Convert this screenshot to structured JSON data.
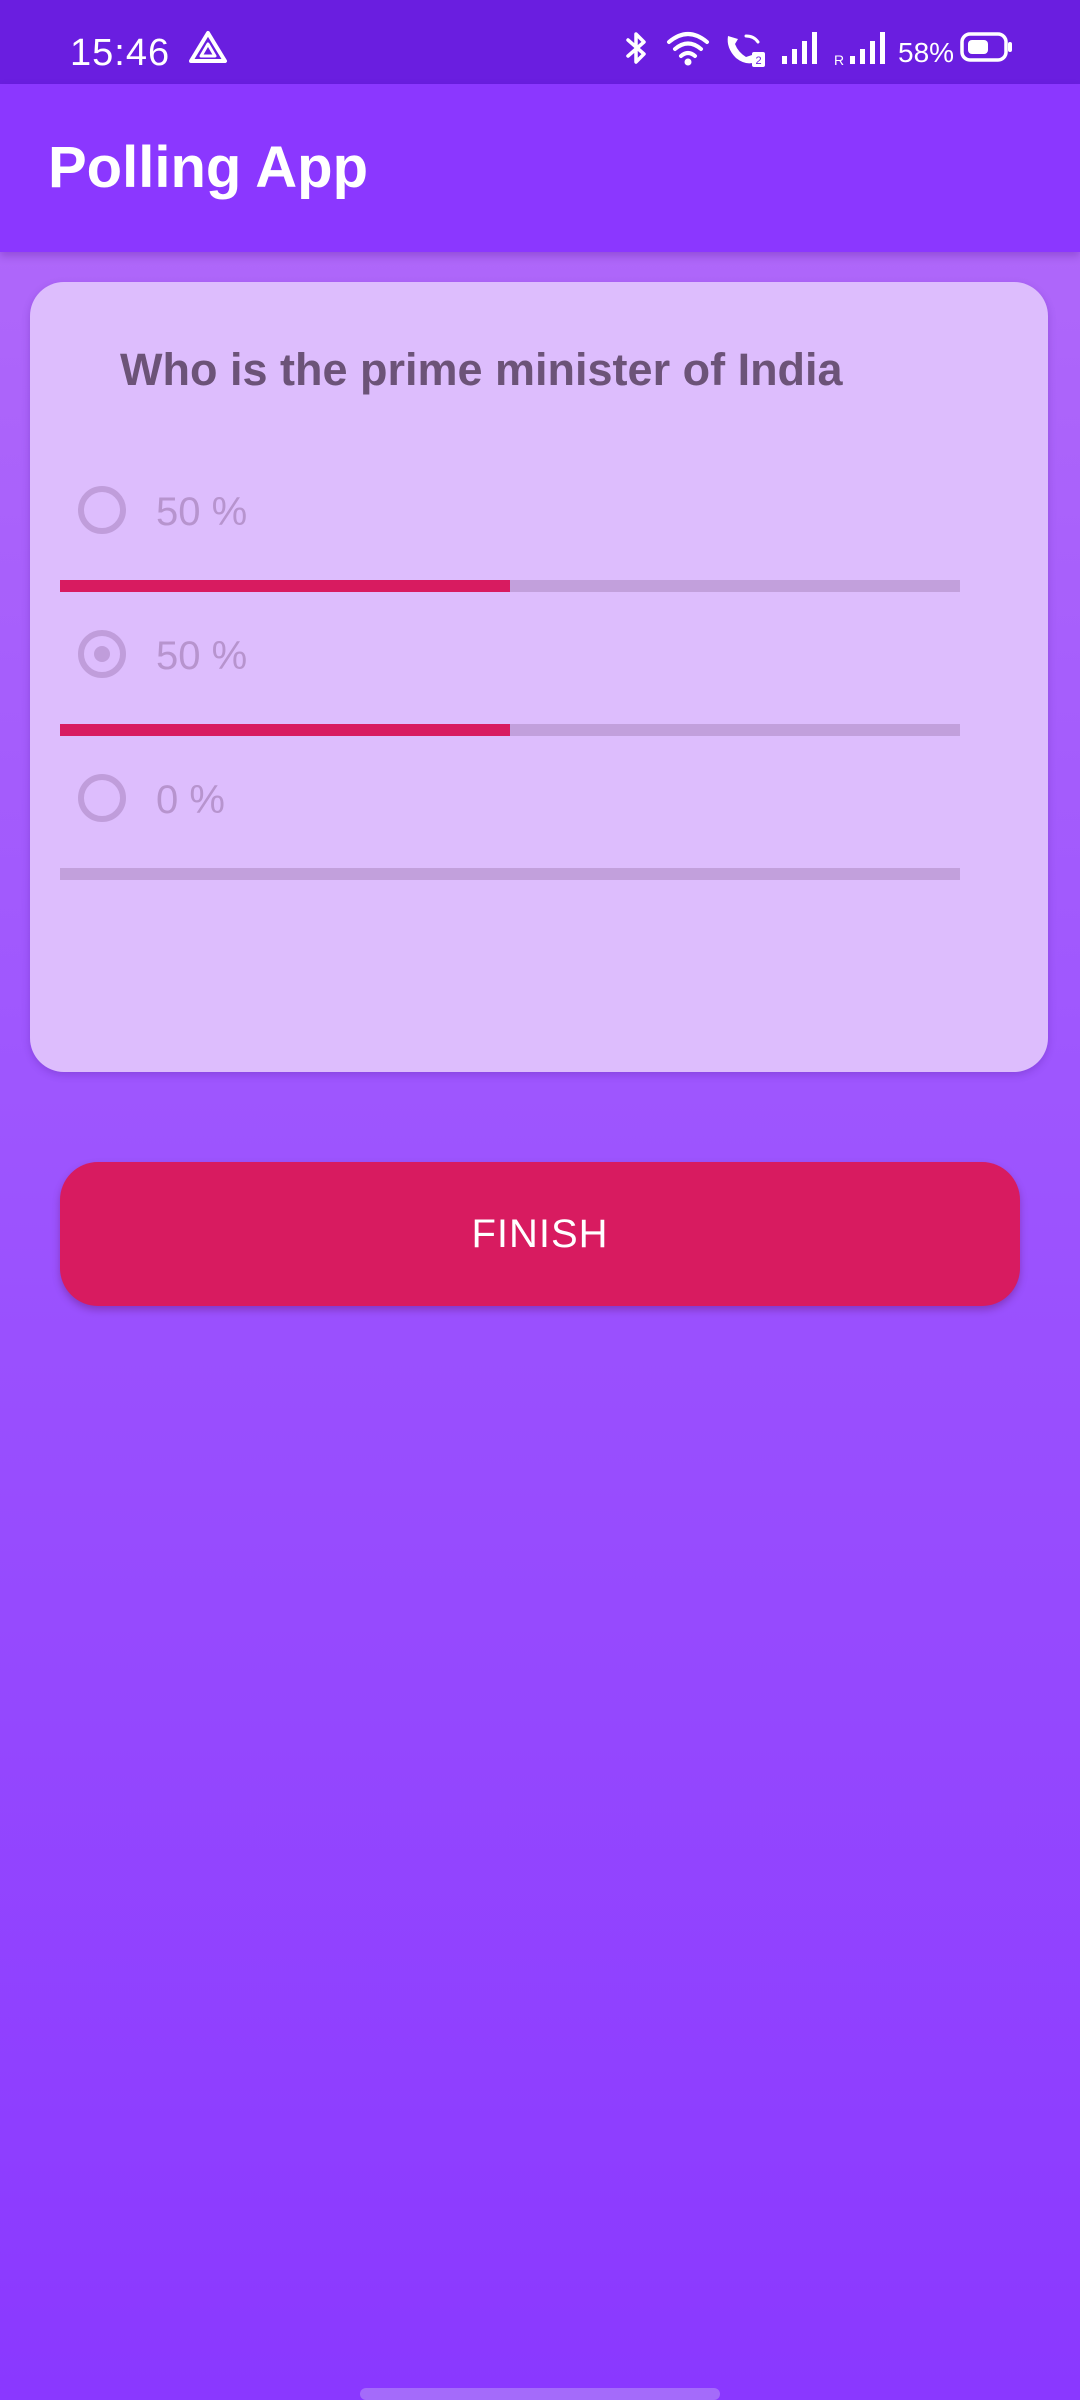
{
  "status_bar": {
    "time": "15:46",
    "battery": "58%",
    "icons": [
      "drive-icon",
      "bluetooth-icon",
      "wifi-icon",
      "wifi-calling-icon",
      "signal-icon",
      "signal-roaming-icon",
      "battery-icon"
    ]
  },
  "app_bar": {
    "title": "Polling App"
  },
  "poll": {
    "question": "Who is the prime minister of India",
    "options": [
      {
        "label": "50 %",
        "percent": 50,
        "selected": false
      },
      {
        "label": "50 %",
        "percent": 50,
        "selected": true
      },
      {
        "label": "0 %",
        "percent": 0,
        "selected": false
      }
    ]
  },
  "finish_button": {
    "label": "FINISH"
  },
  "colors": {
    "status_bar": "#6a1ee0",
    "app_bar": "#8b37ff",
    "card": "#ddbdfd",
    "accent": "#d81b60"
  }
}
